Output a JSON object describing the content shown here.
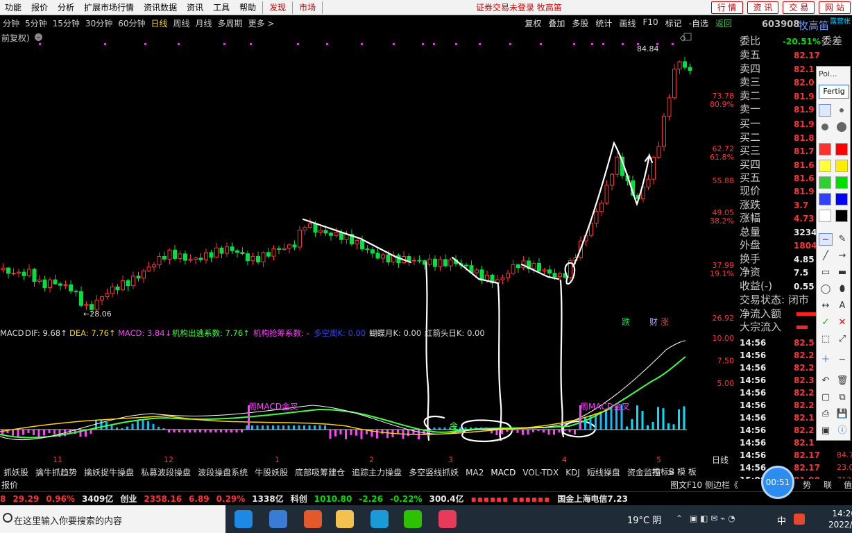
{
  "menu": {
    "items": [
      "功能",
      "报价",
      "分析",
      "扩展市场行情",
      "资讯数据",
      "资讯",
      "工具",
      "帮助"
    ],
    "hot": [
      "发现",
      "市场"
    ],
    "login_status": "证券交易未登录 牧高笛",
    "right_buttons": [
      "行 情",
      "资 讯",
      "交 易",
      "网 站"
    ]
  },
  "periods": [
    "分钟",
    "5分钟",
    "15分钟",
    "30分钟",
    "60分钟",
    "日线",
    "周线",
    "月线",
    "多周期",
    "更多 >"
  ],
  "period_active": "日线",
  "toolbar_right": [
    "复权",
    "叠加",
    "多股",
    "统计",
    "画线",
    "F10",
    "标记",
    "-自选",
    "返回"
  ],
  "restore_label": "前复权)",
  "stock": {
    "code": "603908",
    "name": "牧高笛",
    "tag": "露营帐"
  },
  "price_axis": [
    "84.84",
    "73.78",
    "80.9%",
    "62.72",
    "61.8%",
    "55.88",
    "49.05",
    "38.2%",
    "37.99",
    "19.1%",
    "26.92"
  ],
  "chart_marks": {
    "high": "84.84",
    "low": "28.06"
  },
  "macd_axis": [
    "10.00",
    "7.50",
    "5.00"
  ],
  "macd_header": {
    "name": "MACD",
    "dif": "DIF: 9.68↑",
    "dea": "DEA: 7.76↑",
    "macd": "MACD: 3.84↓",
    "jgcj": "机构出逃系数: 7.76↑",
    "jgqc": "机构抢筹系数: -",
    "dk": "多空周K: 0.00",
    "hdy": "蝴蝶月K: 0.00",
    "hjt": "红箭头日K: 0.00"
  },
  "macd_labels": {
    "gold1": "周MACD金叉",
    "gold2": "周MACD金叉",
    "jin": "金"
  },
  "signal_tags": [
    "跌",
    "财",
    "涨"
  ],
  "months": [
    "11",
    "12",
    "1",
    "2",
    "3",
    "4",
    "5"
  ],
  "quote": {
    "wei_bi_label": "委比",
    "wei_bi": "-20.51%",
    "wei_cha_label": "委差",
    "sell": [
      {
        "label": "卖五",
        "price": "82.17"
      },
      {
        "label": "卖四",
        "price": "82.1"
      },
      {
        "label": "卖三",
        "price": "82.0"
      },
      {
        "label": "卖二",
        "price": "81.9"
      },
      {
        "label": "卖一",
        "price": "81.9"
      }
    ],
    "buy": [
      {
        "label": "买一",
        "price": "81.9"
      },
      {
        "label": "买二",
        "price": "81.8"
      },
      {
        "label": "买三",
        "price": "81.7"
      },
      {
        "label": "买四",
        "price": "81.6"
      },
      {
        "label": "买五",
        "price": "81.6"
      }
    ],
    "stats": [
      {
        "label": "现价",
        "value": "81.9",
        "cls": "red"
      },
      {
        "label": "涨跌",
        "value": "3.7",
        "cls": "red"
      },
      {
        "label": "涨幅",
        "value": "4.73",
        "cls": "red"
      },
      {
        "label": "总量",
        "value": "3234",
        "cls": "white"
      },
      {
        "label": "外盘",
        "value": "1804",
        "cls": "red"
      },
      {
        "label": "换手",
        "value": "4.85",
        "cls": "white"
      },
      {
        "label": "净资",
        "value": "7.5",
        "cls": "white"
      },
      {
        "label": "收益(-)",
        "value": "0.55",
        "cls": "white"
      }
    ],
    "status_label": "交易状态: 闭市",
    "net_inflow_label": "净流入额",
    "big_inflow_label": "大宗流入",
    "ticks": [
      {
        "time": "14:56",
        "price": "82.5"
      },
      {
        "time": "14:56",
        "price": "82.2"
      },
      {
        "time": "14:56",
        "price": "82.2"
      },
      {
        "time": "14:56",
        "price": "82.3"
      },
      {
        "time": "14:56",
        "price": "82.2"
      },
      {
        "time": "14:56",
        "price": "82.2"
      },
      {
        "time": "14:56",
        "price": "82.1"
      },
      {
        "time": "14:56",
        "price": "82.2"
      },
      {
        "time": "14:56",
        "price": "82.1"
      },
      {
        "time": "14:56",
        "price": "82.17",
        "vol": "84.7"
      },
      {
        "time": "14:56",
        "price": "82.17",
        "vol": "23.0"
      },
      {
        "time": "15:00",
        "price": "81.90",
        "vol": "713.3"
      }
    ]
  },
  "palette": {
    "title": "Poi...",
    "font_btn": "Fertig",
    "colors": [
      "#ff3030",
      "#ff0000",
      "#ffff40",
      "#ffee00",
      "#30d030",
      "#00dd00",
      "#3040ff",
      "#0000ff",
      "#ffffff",
      "#000000"
    ]
  },
  "tabs": [
    "抓妖股",
    "擒牛抓趋势",
    "擒妖捉牛操盘",
    "私募波段操盘",
    "波段操盘系统",
    "牛股妖股",
    "底部吸筹建仓",
    "追踪主力操盘",
    "多空竖线抓妖",
    "MA2",
    "MACD",
    "VOL-TDX",
    "KDJ",
    "短线操盘",
    "资金监控",
    ">"
  ],
  "tabs_right": [
    "指标B",
    "模 板"
  ],
  "period_right": "日线",
  "line2": {
    "left": "报价",
    "mid": "图文F10 侧边栏《",
    "right": [
      "势",
      "联",
      "值"
    ]
  },
  "ticker": [
    {
      "text": "8",
      "cls": "red"
    },
    {
      "text": "29.29",
      "cls": "red"
    },
    {
      "text": "0.96%",
      "cls": "red"
    },
    {
      "text": "3409亿",
      "cls": "white"
    },
    {
      "text": "创业",
      "cls": "white"
    },
    {
      "text": "2358.16",
      "cls": "red"
    },
    {
      "text": "6.89",
      "cls": "red"
    },
    {
      "text": "0.29%",
      "cls": "red"
    },
    {
      "text": "1338亿",
      "cls": "white"
    },
    {
      "text": "科创",
      "cls": "white"
    },
    {
      "text": "1010.80",
      "cls": "green"
    },
    {
      "text": "-2.26",
      "cls": "green"
    },
    {
      "text": "-0.22%",
      "cls": "green"
    },
    {
      "text": "300.4亿",
      "cls": "white"
    }
  ],
  "ticker_news": "国金上海电信7.23",
  "timer": "00:51",
  "taskbar": {
    "search": "在这里输入你要搜索的内容",
    "weather": "19°C 阴",
    "lang": "中",
    "time": "14:20",
    "date": "2022/5/1"
  }
}
